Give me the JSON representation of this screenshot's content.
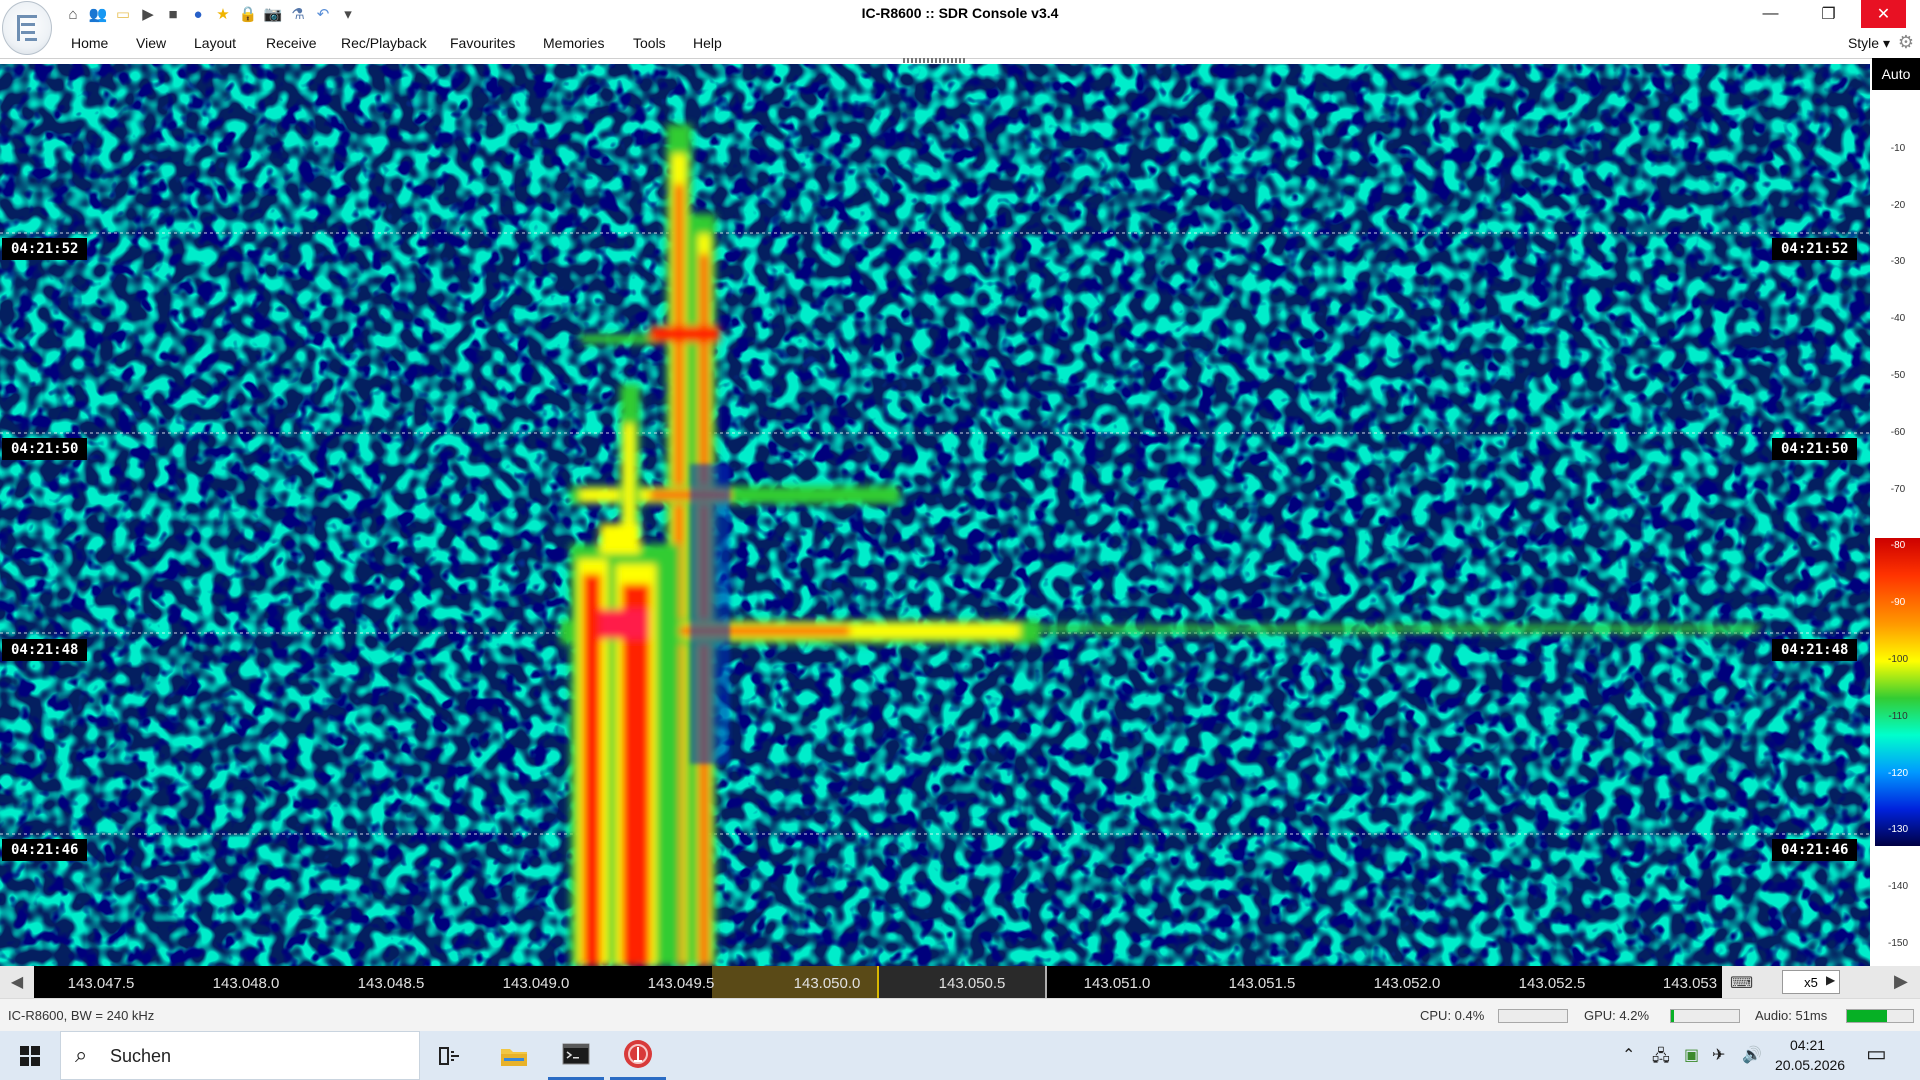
{
  "window": {
    "title": "IC-R8600 :: SDR Console v3.4",
    "controls": {
      "minimize": "—",
      "restore": "❐",
      "close": "✕"
    }
  },
  "quick_access": [
    {
      "icon": "home-icon",
      "glyph": "⌂"
    },
    {
      "icon": "users-icon",
      "glyph": "👥"
    },
    {
      "icon": "folder-icon",
      "glyph": "▭"
    },
    {
      "icon": "play-icon",
      "glyph": "▶"
    },
    {
      "icon": "stop-icon",
      "glyph": "■"
    },
    {
      "icon": "record-icon",
      "glyph": "●"
    },
    {
      "icon": "star-icon",
      "glyph": "★"
    },
    {
      "icon": "lock-icon",
      "glyph": "🔒"
    },
    {
      "icon": "camera-icon",
      "glyph": "📷"
    },
    {
      "icon": "flask-icon",
      "glyph": "⚗"
    },
    {
      "icon": "undo-icon",
      "glyph": "↶"
    },
    {
      "icon": "customize-dropdown-icon",
      "glyph": "▾"
    }
  ],
  "menu": [
    "Home",
    "View",
    "Layout",
    "Receive",
    "Rec/Playback",
    "Favourites",
    "Memories",
    "Tools",
    "Help"
  ],
  "style_menu": {
    "label": "Style",
    "arrow": "▾",
    "settings_glyph": "⚙"
  },
  "waterfall": {
    "time_labels": [
      "04:21:52",
      "04:21:50",
      "04:21:48",
      "04:21:46"
    ],
    "palette": [
      "#000020",
      "#0000cc",
      "#0099ff",
      "#00ffcc",
      "#33cc33",
      "#ffff00",
      "#ff9900",
      "#ff0000"
    ]
  },
  "scale": {
    "auto_label": "Auto",
    "ticks": [
      "-10",
      "-20",
      "-30",
      "-40",
      "-50",
      "-60",
      "-70",
      "-80",
      "-90",
      "-100",
      "-110",
      "-120",
      "-130",
      "-140",
      "-150"
    ]
  },
  "frequency_axis": {
    "labels": [
      "143.047.5",
      "143.048.0",
      "143.048.5",
      "143.049.0",
      "143.049.5",
      "143.050.0",
      "143.050.5",
      "143.051.0",
      "143.051.5",
      "143.052.0",
      "143.052.5",
      "143.053"
    ],
    "zoom": "x5",
    "left_glyph": "◀",
    "right_glyph": "▶",
    "keyboard_glyph": "⌨"
  },
  "status": {
    "radio": "IC-R8600, BW = 240 kHz",
    "cpu_label": "CPU: 0.4%",
    "cpu_level": 0.004,
    "gpu_label": "GPU: 4.2%",
    "gpu_level": 0.042,
    "audio_label": "Audio: 51ms",
    "audio_level": 0.6
  },
  "taskbar": {
    "search_placeholder": "Suchen",
    "time": "04:21",
    "date": "20.05.2026",
    "tray_glyphs": [
      "⌃",
      "🖧",
      "▣",
      "✈",
      "🔊"
    ]
  }
}
